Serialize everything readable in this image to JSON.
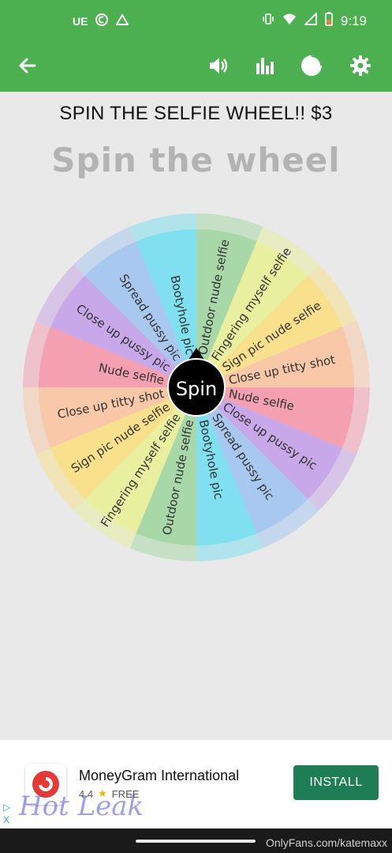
{
  "status_bar": {
    "carrier": "UE",
    "time": "9:19",
    "icons": [
      "circle-c-icon",
      "triangle-icon",
      "vibrate-icon",
      "wifi-icon",
      "signal-icon",
      "battery-icon"
    ]
  },
  "app_bar": {
    "icons": [
      "back-arrow-icon",
      "volume-icon",
      "bar-chart-icon",
      "pie-chart-icon",
      "gear-icon"
    ]
  },
  "main": {
    "headline": "SPIN THE SELFIE WHEEL!! $3",
    "subhead": "Spin the wheel"
  },
  "wheel": {
    "spin_label": "Spin",
    "segments": [
      {
        "label": "Outdoor nude selfie",
        "color": "#a8d8a8"
      },
      {
        "label": "Fingering myself selfie",
        "color": "#e8f0a0"
      },
      {
        "label": "Sign pic nude selfie",
        "color": "#f8e08c"
      },
      {
        "label": "Close up titty shot",
        "color": "#f8c8a8"
      },
      {
        "label": "Nude selfie",
        "color": "#f4a0b0"
      },
      {
        "label": "Close up pussy pic",
        "color": "#c8a8e8"
      },
      {
        "label": "Spread pussy pic",
        "color": "#a8c8f0"
      },
      {
        "label": "Bootyhole pic",
        "color": "#80e0f0"
      },
      {
        "label": "Outdoor nude selfie",
        "color": "#a8d8a8"
      },
      {
        "label": "Fingering myself selfie",
        "color": "#e8f0a0"
      },
      {
        "label": "Sign pic nude selfie",
        "color": "#f8e08c"
      },
      {
        "label": "Close up titty shot",
        "color": "#f8c8a8"
      },
      {
        "label": "Nude selfie",
        "color": "#f4a0b0"
      },
      {
        "label": "Close up pussy pic",
        "color": "#c8a8e8"
      },
      {
        "label": "Spread pussy pic",
        "color": "#a8c8f0"
      },
      {
        "label": "Bootyhole pic",
        "color": "#80e0f0"
      }
    ]
  },
  "ad": {
    "title": "MoneyGram International",
    "rating": "4.4",
    "price": "FREE",
    "install_label": "INSTALL",
    "choices_icon": "ad-choices-icon",
    "close_label": "X"
  },
  "watermark": {
    "site": "OnlyFans.com/katemaxx",
    "logo_text": "Hot Leak"
  },
  "colors": {
    "accent": "#4caf50",
    "install": "#1e7d53",
    "hub": "#000000"
  }
}
